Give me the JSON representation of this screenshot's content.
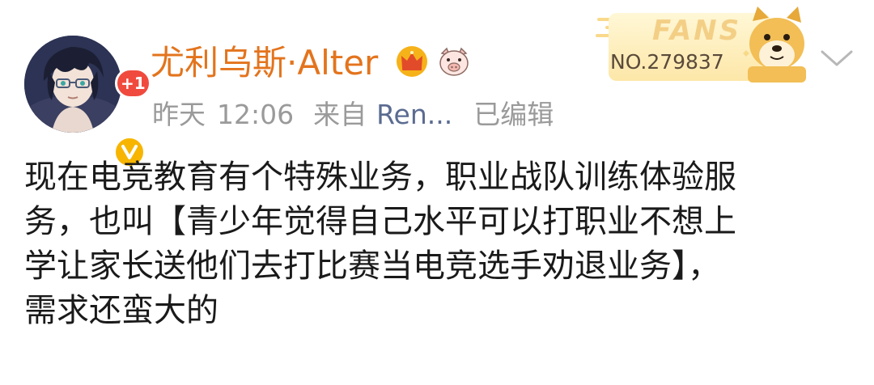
{
  "user": {
    "name": "尤利乌斯·Alter",
    "notification_count": "+1",
    "crown_icon": "crown-badge-icon",
    "pig_icon": "pig-face-icon",
    "verified_icon": "verified-v-icon"
  },
  "meta": {
    "day": "昨天",
    "time": "12:06",
    "from_label": "来自",
    "source": "Ren...",
    "edited": "已编辑"
  },
  "fans_card": {
    "label": "FANS",
    "number": "NO.279837",
    "mascot_icon": "doge-icon"
  },
  "menu": {
    "icon": "chevron-down-icon"
  },
  "post": {
    "lines": [
      "现在电竞教育有个特殊业务，职业战队训练体验服",
      "务，也叫【青少年觉得自己水平可以打职业不想上",
      "学让家长送他们去打比赛当电竞选手劝退业务】，",
      "需求还蛮大的"
    ]
  },
  "colors": {
    "username": "#e3741d",
    "meta_gray": "#9a9a9a",
    "source_blue": "#5b6b91",
    "badge_red": "#f04a3e",
    "verified_yellow": "#f7b500",
    "body_text": "#1a1a1a"
  }
}
